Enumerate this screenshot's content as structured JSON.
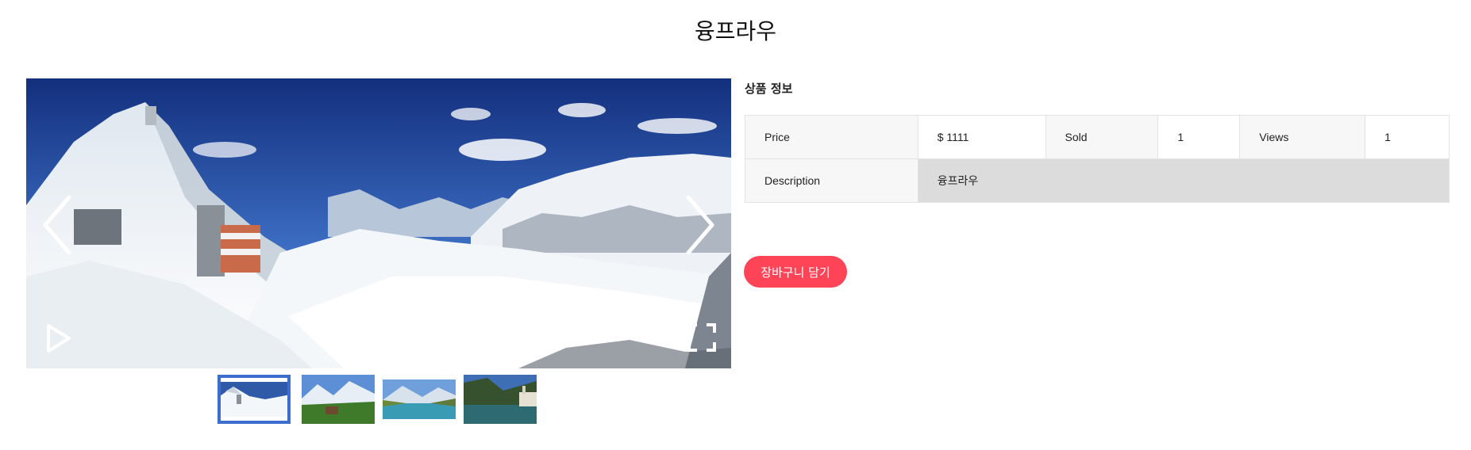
{
  "page": {
    "title": "융프라우"
  },
  "gallery": {
    "controls": {
      "prev_icon": "chevron-left-icon",
      "next_icon": "chevron-right-icon",
      "play_icon": "play-icon",
      "fullscreen_icon": "fullscreen-icon"
    },
    "thumbnails_count": 4,
    "active_thumbnail": 1
  },
  "product_info": {
    "section_title": "상품 정보",
    "price_label": "Price",
    "price_value": "$ 1111",
    "sold_label": "Sold",
    "sold_value": "1",
    "views_label": "Views",
    "views_value": "1",
    "description_label": "Description",
    "description_value": "융프라우"
  },
  "actions": {
    "add_to_cart_label": "장바구니 담기"
  },
  "colors": {
    "accent": "#ff4458",
    "thumbnail_active": "#3d6ecf"
  }
}
